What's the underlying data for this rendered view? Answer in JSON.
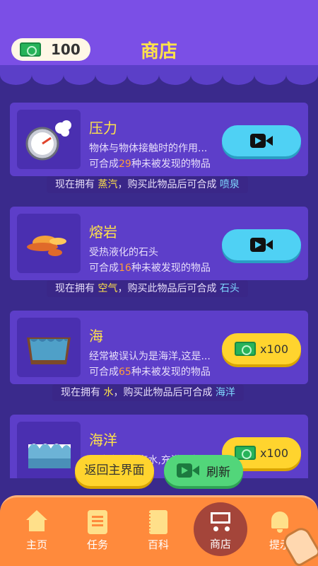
{
  "header": {
    "title": "商店",
    "coins": "100"
  },
  "items": [
    {
      "name": "压力",
      "desc": "物体与物体接触时的作用...",
      "count_prefix": "可合成",
      "count": "29",
      "count_suffix": "种未被发现的物品",
      "buy": "video",
      "hint_prefix": "现在拥有",
      "have": "蒸汽",
      "hint_mid": "，购买此物品后可合成",
      "result": "喷泉"
    },
    {
      "name": "熔岩",
      "desc": "受热液化的石头",
      "count_prefix": "可合成",
      "count": "16",
      "count_suffix": "种未被发现的物品",
      "buy": "video",
      "hint_prefix": "现在拥有",
      "have": "空气",
      "hint_mid": "，购买此物品后可合成",
      "result": "石头"
    },
    {
      "name": "海",
      "desc": "经常被误认为是海洋,这是...",
      "count_prefix": "可合成",
      "count": "65",
      "count_suffix": "种未被发现的物品",
      "buy": "cash",
      "price": "x100",
      "hint_prefix": "现在拥有",
      "have": "水",
      "hint_mid": "，购买此物品后可合成",
      "result": "海洋"
    },
    {
      "name": "海洋",
      "desc": "...比大河的海水,充满了鱼",
      "buy": "cash",
      "price": "x100"
    }
  ],
  "actions": {
    "back": "返回主界面",
    "refresh": "刷新"
  },
  "nav": {
    "home": "主页",
    "tasks": "任务",
    "wiki": "百科",
    "shop": "商店",
    "tips": "提示"
  }
}
